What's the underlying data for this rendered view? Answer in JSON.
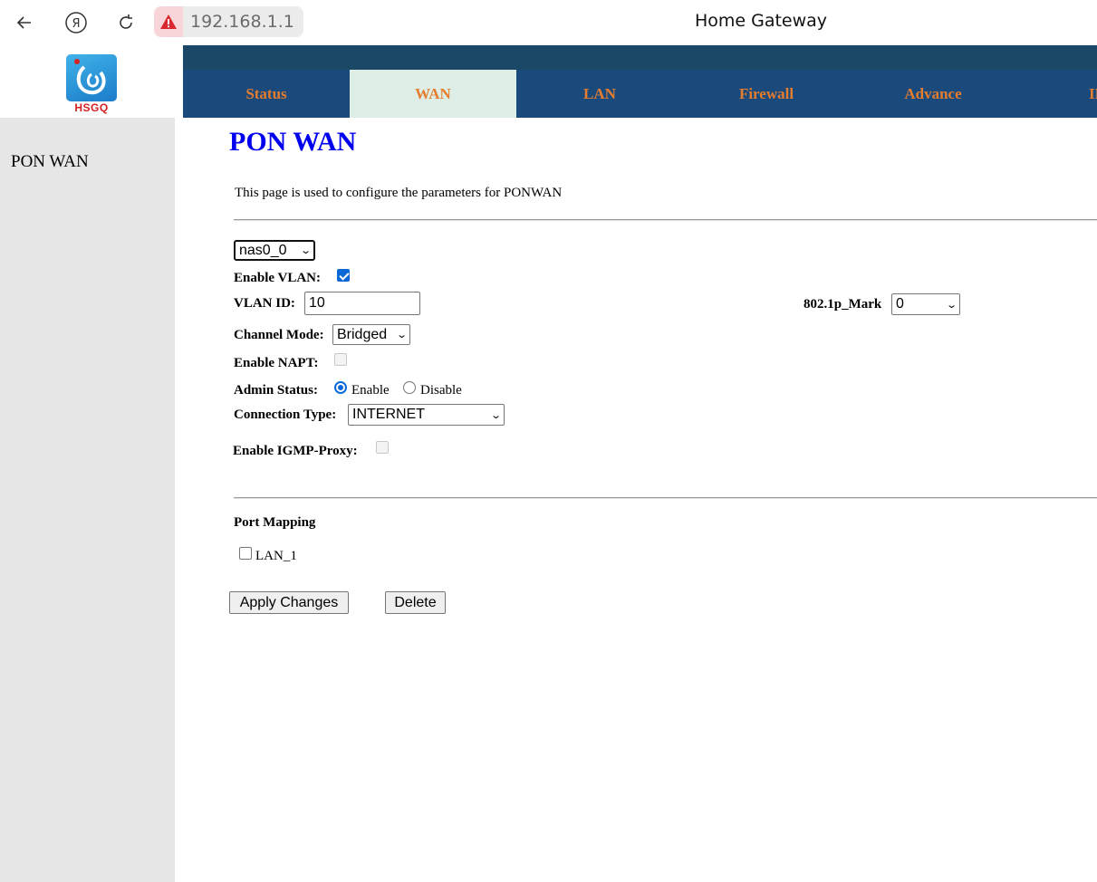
{
  "browser": {
    "url": "192.168.1.1",
    "tab_title": "Home Gateway",
    "icons": {
      "back": "arrow-left-icon",
      "yandex": "yandex-icon",
      "reload": "reload-icon",
      "warning": "warning-icon"
    }
  },
  "logo": {
    "brand": "HSGQ"
  },
  "tabs": [
    {
      "label": "Status",
      "active": false
    },
    {
      "label": "WAN",
      "active": true
    },
    {
      "label": "LAN",
      "active": false
    },
    {
      "label": "Firewall",
      "active": false
    },
    {
      "label": "Advance",
      "active": false
    },
    {
      "label": "IP",
      "active": false
    }
  ],
  "sidebar": {
    "items": [
      {
        "label": "PON WAN"
      }
    ]
  },
  "page": {
    "heading": "PON WAN",
    "description": "This page is used to configure the parameters for PONWAN"
  },
  "form": {
    "interface_select": {
      "value": "nas0_0"
    },
    "enable_vlan": {
      "label": "Enable VLAN:",
      "checked": true
    },
    "vlan_id": {
      "label": "VLAN ID:",
      "value": "10"
    },
    "mark_8021p": {
      "label": "802.1p_Mark",
      "value": "0"
    },
    "channel_mode": {
      "label": "Channel Mode:",
      "value": "Bridged"
    },
    "enable_napt": {
      "label": "Enable NAPT:",
      "checked": false,
      "disabled": true
    },
    "admin_status": {
      "label": "Admin Status:",
      "options": [
        "Enable",
        "Disable"
      ],
      "selected": "Enable"
    },
    "connection_type": {
      "label": "Connection Type:",
      "value": "INTERNET"
    },
    "igmp_proxy": {
      "label": "Enable IGMP-Proxy:",
      "checked": false,
      "disabled": true
    }
  },
  "port_mapping": {
    "title": "Port Mapping",
    "ports": [
      {
        "label": "LAN_1",
        "checked": false
      }
    ]
  },
  "buttons": {
    "apply": "Apply Changes",
    "delete": "Delete"
  },
  "colors": {
    "tab_bar": "#1a4a7c",
    "top_band": "#1a4866",
    "tab_text": "#e47d2e",
    "active_tab_bg": "#deede5",
    "heading": "#0000ee",
    "sidebar_bg": "#e6e6e6"
  }
}
